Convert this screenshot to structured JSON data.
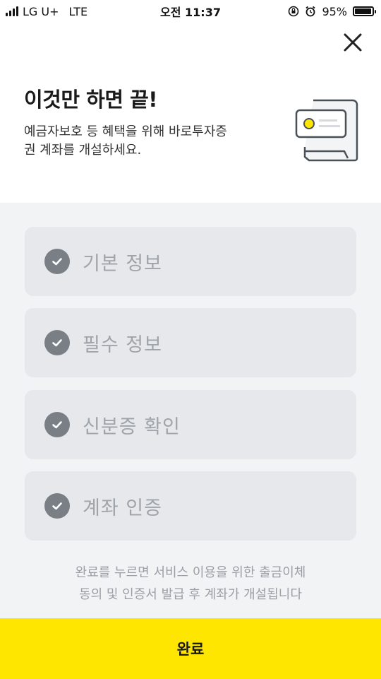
{
  "status_bar": {
    "carrier": "LG U+",
    "network": "LTE",
    "time": "오전 11:37",
    "battery": "95%",
    "battery_level": 0.95
  },
  "header": {
    "title": "이것만 하면 끝!",
    "description_line1": "예금자보호 등 혜택을 위해 바로투자증",
    "description_line2": "권 계좌를 개설하세요."
  },
  "steps": [
    {
      "label": "기본 정보",
      "completed": true
    },
    {
      "label": "필수 정보",
      "completed": true
    },
    {
      "label": "신분증 확인",
      "completed": true
    },
    {
      "label": "계좌 인증",
      "completed": true
    }
  ],
  "notice": {
    "line1": "완료를 누르면 서비스 이용을 위한 출금이체",
    "line2": "동의 및 인증서 발급 후 계좌가 개설됩니다"
  },
  "footer": {
    "complete_label": "완료"
  },
  "colors": {
    "accent": "#ffe600",
    "step_background": "#e6e8eb",
    "check_circle": "#7a7f86",
    "content_background": "#f2f3f5"
  },
  "icons": [
    "signal-icon",
    "rotation-lock-icon",
    "alarm-icon",
    "battery-icon",
    "close-icon",
    "document-card-icon",
    "check-icon"
  ]
}
